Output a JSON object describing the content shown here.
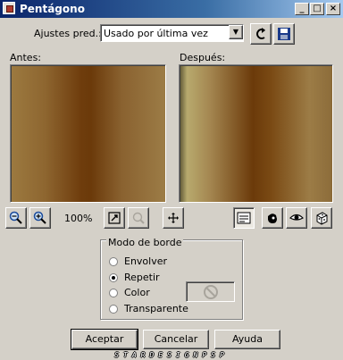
{
  "window": {
    "title": "Pentágono",
    "minimize_glyph": "_",
    "maximize_glyph": "□",
    "close_glyph": "×"
  },
  "presets": {
    "label": "Ajustes pred.:",
    "selected": "Usado por última vez"
  },
  "previews": {
    "before_label": "Antes:",
    "after_label": "Después:"
  },
  "zoom": {
    "level": "100%"
  },
  "border_mode": {
    "legend": "Modo de borde",
    "options": [
      "Envolver",
      "Repetir",
      "Color",
      "Transparente"
    ],
    "selected": "Repetir"
  },
  "buttons": {
    "ok": "Aceptar",
    "cancel": "Cancelar",
    "help": "Ayuda"
  },
  "watermark": "STARDESIGNPSP",
  "colors": {
    "titlebar": "#0a246a",
    "face": "#d4d0c8"
  },
  "icons": {
    "preset_tools": [
      "reset-arrow-icon",
      "save-disk-icon"
    ],
    "zoom_tools": [
      "zoom-out-icon",
      "zoom-in-icon",
      "proof-icon",
      "zoom-disabled-icon",
      "pan-icon"
    ],
    "view_tools": [
      "toggle-preview-icon",
      "randomize-hand-icon",
      "eye-icon",
      "dice-icon"
    ]
  }
}
